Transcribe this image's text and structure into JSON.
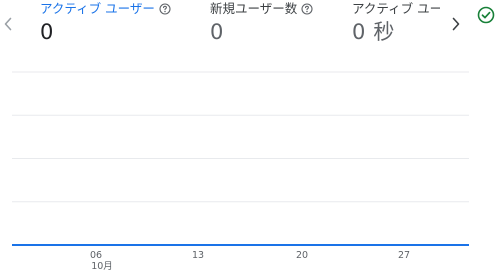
{
  "metrics": [
    {
      "label": "アクティブ ユーザー",
      "value": "0",
      "active": true
    },
    {
      "label": "新規ユーザー数",
      "value": "0",
      "active": false
    },
    {
      "label": "アクティブ ユー",
      "value": "0",
      "unit": "秒",
      "active": false
    }
  ],
  "icons": {
    "prev": "chevron-left-icon",
    "next": "chevron-right-icon",
    "help": "help-circle-icon",
    "status": "check-circle-icon"
  },
  "colors": {
    "accent": "#1a73e8",
    "status": "#188038",
    "grid": "#e8eaed",
    "axis_line": "#1a73e8"
  },
  "chart_data": {
    "type": "line",
    "title": "",
    "xlabel": "",
    "ylabel": "",
    "x_tick_labels": [
      "06",
      "13",
      "20",
      "27"
    ],
    "x_month_label": "10月",
    "series": [
      {
        "values": [
          0,
          0,
          0,
          0
        ]
      }
    ],
    "ylim": [
      0,
      4
    ],
    "grid": true,
    "legend": "none"
  }
}
